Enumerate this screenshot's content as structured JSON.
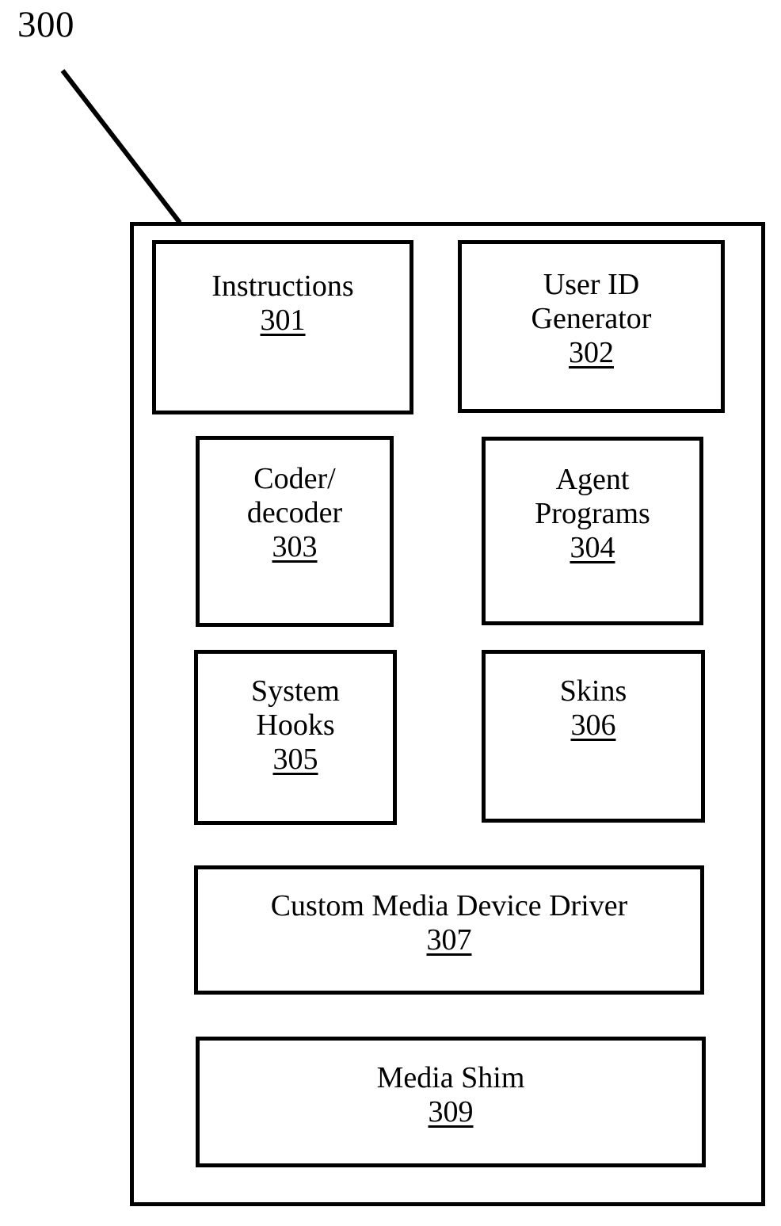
{
  "figure": {
    "number": "300",
    "title_label": "300"
  },
  "container": {
    "name": "system-container"
  },
  "components": [
    {
      "id": "instructions",
      "title": "Instructions",
      "ref": "301"
    },
    {
      "id": "userid",
      "title": "User ID\nGenerator",
      "ref": "302"
    },
    {
      "id": "codec",
      "title": "Coder/\ndecoder",
      "ref": "303"
    },
    {
      "id": "agent",
      "title": "Agent\nPrograms",
      "ref": "304"
    },
    {
      "id": "hooks",
      "title": "System\nHooks",
      "ref": "305"
    },
    {
      "id": "skins",
      "title": "Skins",
      "ref": "306"
    },
    {
      "id": "driver",
      "title": "Custom Media Device Driver",
      "ref": "307"
    },
    {
      "id": "shim",
      "title": "Media Shim",
      "ref": "309"
    }
  ],
  "style": {
    "line_color": "#000000",
    "background_color": "#ffffff"
  }
}
